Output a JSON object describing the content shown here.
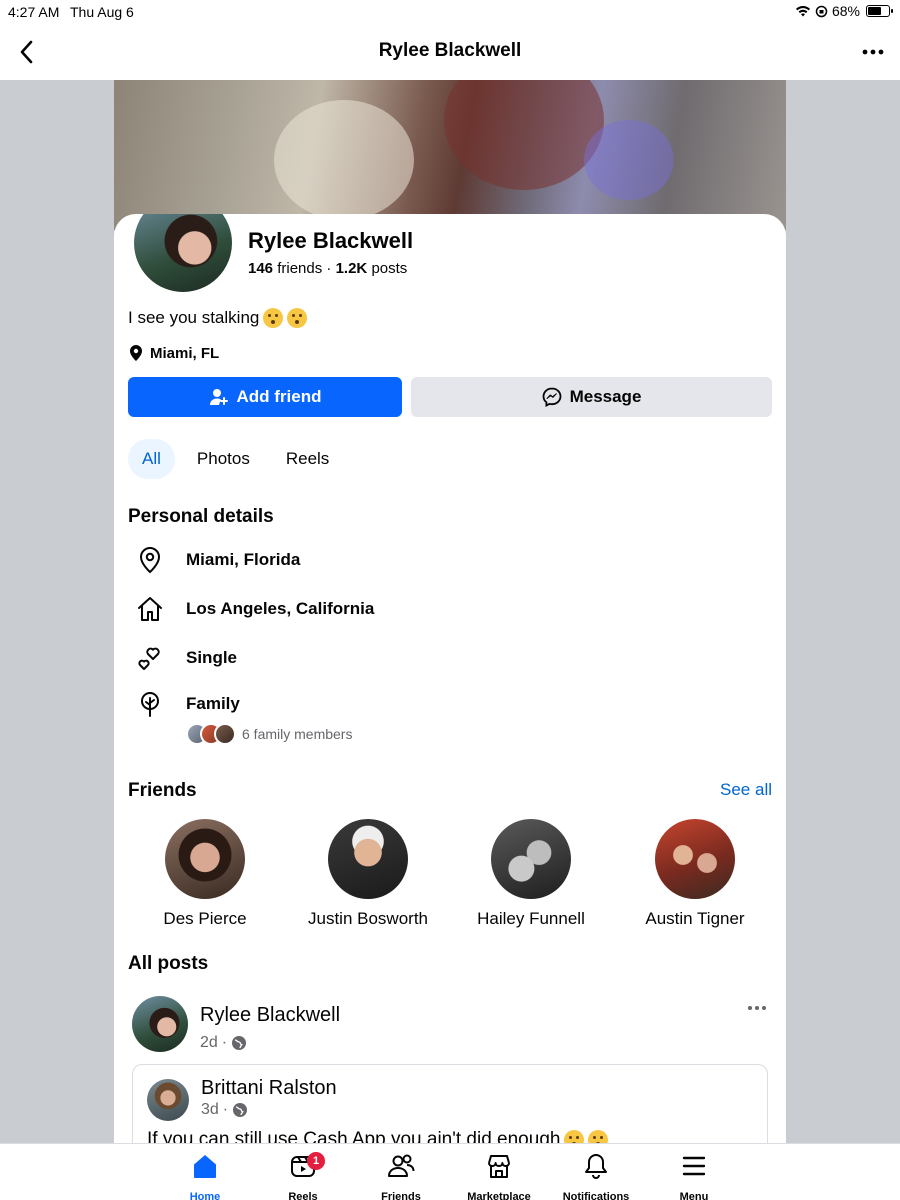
{
  "status_bar": {
    "time": "4:27 AM",
    "date": "Thu Aug 6",
    "battery": "68%",
    "battery_level": 0.68
  },
  "header": {
    "title": "Rylee Blackwell"
  },
  "profile": {
    "name": "Rylee Blackwell",
    "friends_count": "146",
    "friends_label": "friends",
    "posts_count": "1.2K",
    "posts_label": "posts",
    "bio": "I see you stalking",
    "location": "Miami, FL"
  },
  "actions": {
    "add_friend": "Add friend",
    "message": "Message"
  },
  "tabs": [
    {
      "label": "All",
      "active": true
    },
    {
      "label": "Photos"
    },
    {
      "label": "Reels"
    }
  ],
  "personal_details": {
    "title": "Personal details",
    "items": [
      {
        "icon": "location-pin-icon",
        "label": "Miami, Florida"
      },
      {
        "icon": "home-icon",
        "label": "Los Angeles, California"
      },
      {
        "icon": "hearts-icon",
        "label": "Single"
      },
      {
        "icon": "family-tree-icon",
        "label": "Family"
      }
    ],
    "family_members": "6 family members"
  },
  "friends": {
    "title": "Friends",
    "see_all": "See all",
    "list": [
      {
        "name": "Des Pierce"
      },
      {
        "name": "Justin Bosworth"
      },
      {
        "name": "Hailey Funnell"
      },
      {
        "name": "Austin Tigner"
      }
    ]
  },
  "posts": {
    "title": "All posts",
    "author": "Rylee Blackwell",
    "time": "2d",
    "shared": {
      "author": "Brittani Ralston",
      "time": "3d",
      "text": "If you can still use Cash App you ain't did enough"
    }
  },
  "bottom_nav": {
    "items": [
      {
        "label": "Home",
        "active": true
      },
      {
        "label": "Reels",
        "badge": "1"
      },
      {
        "label": "Friends"
      },
      {
        "label": "Marketplace"
      },
      {
        "label": "Notifications"
      },
      {
        "label": "Menu"
      }
    ]
  },
  "colors": {
    "accent": "#0866ff",
    "link": "#0064d1",
    "badge": "#e41e3f"
  }
}
